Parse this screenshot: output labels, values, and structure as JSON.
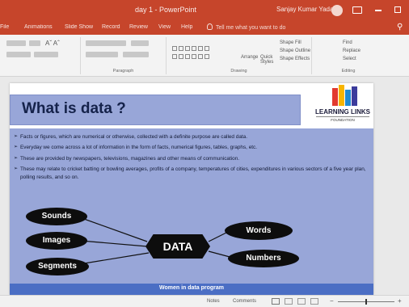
{
  "window": {
    "title": "day 1  -  PowerPoint",
    "user_name": "Sanjay Kumar Yadav"
  },
  "tabs": [
    "File",
    "Animations",
    "Slide Show",
    "Record",
    "Review",
    "View",
    "Help"
  ],
  "tell_me": {
    "placeholder": "Tell me what you want to do"
  },
  "ribbon": {
    "groups": {
      "font": "",
      "paragraph": "Paragraph",
      "drawing": "Drawing",
      "editing": "Editing"
    },
    "labels": {
      "arrange": "Arrange",
      "quick_styles": "Quick Styles",
      "shape_fill": "Shape Fill",
      "shape_outline": "Shape Outline",
      "shape_effects": "Shape Effects",
      "find": "Find",
      "replace": "Replace",
      "select": "Select"
    }
  },
  "slide": {
    "title": "What is data ?",
    "logo": {
      "name": "LEARNING LINKS",
      "subline": "FOUNDATION",
      "bar_colors": [
        "#e23a2f",
        "#f7b500",
        "#1f8bd3",
        "#3c3c9c",
        "#2aa84a"
      ]
    },
    "bullets": [
      "Facts or figures, which are numerical or otherwise, collected with a definite purpose are called data.",
      "Everyday we come across a lot of information in the form of facts, numerical figures, tables, graphs, etc.",
      "These are provided by newspapers, televisions, magazines and other means of communication.",
      "These may relate to cricket batting or bowling averages, profits of a company, temperatures of cities, expenditures in various sectors of a five year plan, polling results, and so on."
    ],
    "diagram": {
      "center": "DATA",
      "left": [
        "Sounds",
        "Images",
        "Segments"
      ],
      "right": [
        "Words",
        "Numbers"
      ]
    },
    "footer": "Women in data program"
  },
  "status": {
    "notes": "Notes",
    "comments": "Comments",
    "zoom": ""
  },
  "colors": {
    "accent": "#c6452b",
    "slide_panel": "#98a6d8",
    "footer_bar": "#4b6ec4"
  }
}
